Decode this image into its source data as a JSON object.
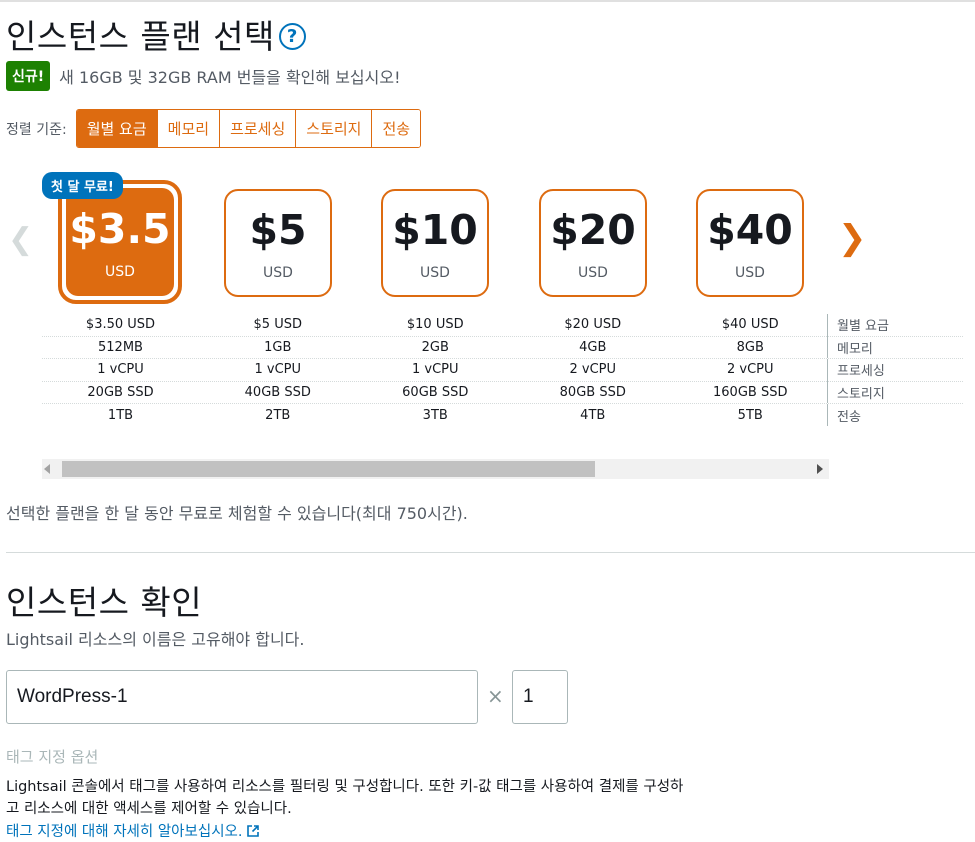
{
  "header": {
    "title": "인스턴스 플랜 선택",
    "help_symbol": "?"
  },
  "announcement": {
    "badge": "신규!",
    "text": "새 16GB 및 32GB RAM 번들을 확인해 보십시오!"
  },
  "sort": {
    "label": "정렬 기준:",
    "options": [
      "월별 요금",
      "메모리",
      "프로세싱",
      "스토리지",
      "전송"
    ],
    "selected": "월별 요금"
  },
  "plans": [
    {
      "price": "$3.5",
      "currency": "USD",
      "monthly": "$3.50 USD",
      "memory": "512MB",
      "processing": "1 vCPU",
      "storage": "20GB SSD",
      "transfer": "1TB",
      "selected": true,
      "tag": "첫 달 무료!"
    },
    {
      "price": "$5",
      "currency": "USD",
      "monthly": "$5 USD",
      "memory": "1GB",
      "processing": "1 vCPU",
      "storage": "40GB SSD",
      "transfer": "2TB"
    },
    {
      "price": "$10",
      "currency": "USD",
      "monthly": "$10 USD",
      "memory": "2GB",
      "processing": "1 vCPU",
      "storage": "60GB SSD",
      "transfer": "3TB"
    },
    {
      "price": "$20",
      "currency": "USD",
      "monthly": "$20 USD",
      "memory": "4GB",
      "processing": "2 vCPU",
      "storage": "80GB SSD",
      "transfer": "4TB"
    },
    {
      "price": "$40",
      "currency": "USD",
      "monthly": "$40 USD",
      "memory": "8GB",
      "processing": "2 vCPU",
      "storage": "160GB SSD",
      "transfer": "5TB"
    }
  ],
  "spec_labels": [
    "월별 요금",
    "메모리",
    "프로세싱",
    "스토리지",
    "전송"
  ],
  "nav": {
    "prev_icon": "chevron-left-icon",
    "next_icon": "chevron-right-icon"
  },
  "free_note": "선택한 플랜을 한 달 동안 무료로 체험할 수 있습니다(최대 750시간).",
  "confirm": {
    "title": "인스턴스 확인",
    "unique_note": "Lightsail 리소스의 이름은 고유해야 합니다.",
    "name_value": "WordPress-1",
    "times_symbol": "×",
    "count_value": "1"
  },
  "tags": {
    "title": "태그 지정 옵션",
    "description": "Lightsail 콘솔에서 태그를 사용하여 리소스를 필터링 및 구성합니다. 또한 키-값 태그를 사용하여 결제를 구성하고 리소스에 대한 액세스를 제어할 수 있습니다.",
    "link": "태그 지정에 대해 자세히 알아보십시오."
  },
  "colors": {
    "accent": "#dd6b10",
    "new_badge": "#1d8102",
    "link": "#0073bb"
  }
}
